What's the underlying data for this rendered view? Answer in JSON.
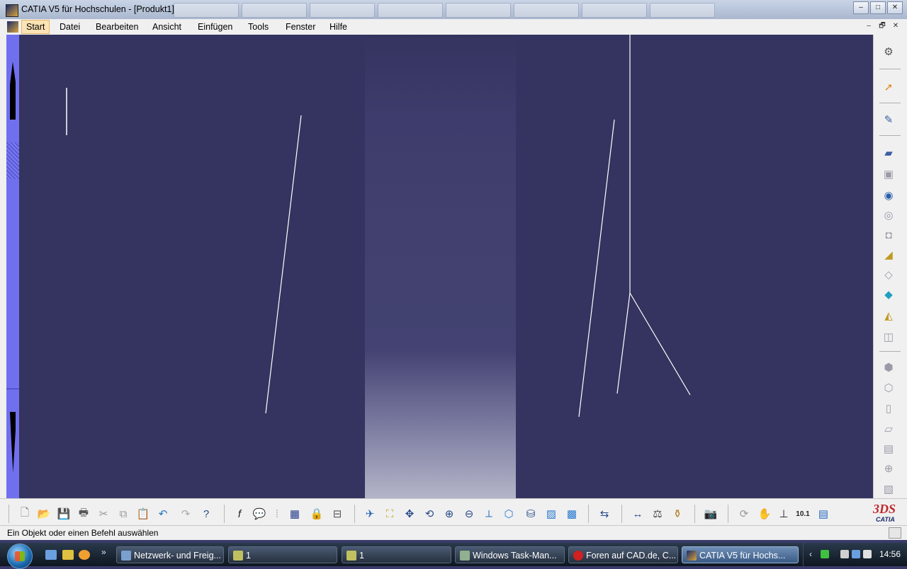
{
  "window": {
    "title": "CATIA V5 für Hochschulen - [Produkt1]",
    "min": "–",
    "max": "□",
    "close": "✕"
  },
  "menubar": {
    "items": [
      "Start",
      "Datei",
      "Bearbeiten",
      "Ansicht",
      "Einfügen",
      "Tools",
      "Fenster",
      "Hilfe"
    ],
    "mdi": [
      "–",
      "🗗",
      "✕"
    ]
  },
  "right_toolbar": {
    "icons": [
      "gear-icon",
      "select-arrow-icon",
      "sketch-icon",
      "pad-icon",
      "pocket-icon",
      "shaft-icon",
      "groove-icon",
      "hole-icon",
      "rib-icon",
      "slot-icon",
      "box-icon",
      "loft-icon",
      "remove-icon",
      "shell-icon",
      "thickness-icon",
      "thread-icon",
      "draft-icon",
      "split-icon",
      "multi-icon",
      "target-icon",
      "misc-icon"
    ]
  },
  "bottom_toolbar": {
    "icons": [
      "new-icon",
      "open-icon",
      "save-icon",
      "print-icon",
      "cut-icon",
      "copy-icon",
      "paste-icon",
      "undo-icon",
      "redo-icon",
      "whats-this-icon",
      "formula-icon",
      "comment-icon",
      "knowledge-icon",
      "table-icon",
      "lock-icon",
      "catalog-icon",
      "fly-icon",
      "fit-all-icon",
      "pan-icon",
      "rotate-icon",
      "zoom-in-icon",
      "zoom-out-icon",
      "normal-view-icon",
      "iso-view-icon",
      "view-mode-icon",
      "render-icon",
      "shading-icon",
      "hide-show-icon",
      "measure-icon",
      "inertia-icon",
      "weight-icon",
      "camera-icon",
      "update-icon",
      "hand-icon",
      "axis-icon",
      "decimal-icon",
      "scene-icon"
    ],
    "logo_text": "CATIA"
  },
  "status": {
    "message": "Ein Objekt oder einen Befehl auswählen"
  },
  "taskbar": {
    "tasks": [
      {
        "label": "Netzwerk- und Freig...",
        "active": false
      },
      {
        "label": "1",
        "active": false
      },
      {
        "label": "1",
        "active": false
      },
      {
        "label": "Windows Task-Man...",
        "active": false
      },
      {
        "label": "Foren auf CAD.de, C...",
        "active": false
      },
      {
        "label": "CATIA V5 für Hochs...",
        "active": true
      }
    ],
    "more": "»",
    "tray_chevron": "‹",
    "clock": "14:56"
  },
  "colors": {
    "viewport_bg": "#35335f",
    "left_bar": "#7070ee",
    "menu_active": "#fbe3b4"
  }
}
